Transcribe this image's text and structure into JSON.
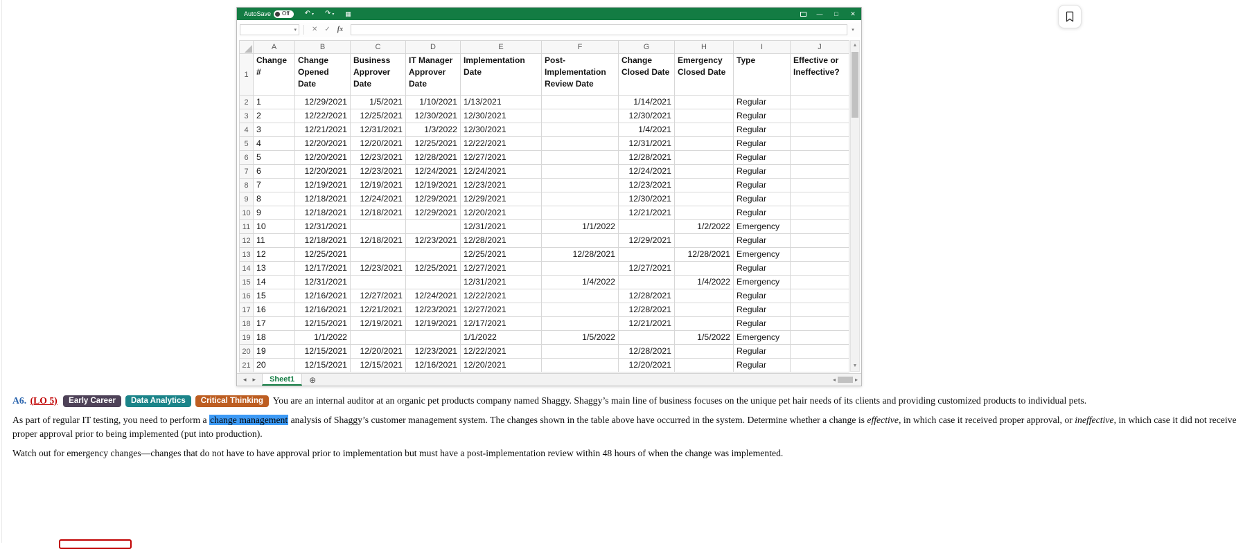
{
  "icons": {
    "undo": "↶",
    "redo": "↷",
    "grid": "▦",
    "minimize": "—",
    "maximize": "□",
    "close": "✕",
    "name_box_dropdown": "▾",
    "cancel": "✕",
    "enter": "✓",
    "expand": "▾",
    "scroll_up": "▲",
    "scroll_down": "▼",
    "scroll_left": "◂",
    "scroll_right": "▸",
    "nav_left": "◂",
    "nav_right": "▸",
    "add_sheet": "⊕",
    "caret": "▾"
  },
  "excel": {
    "titlebar": {
      "autosave_label": "AutoSave",
      "autosave_state": "Off"
    },
    "formula_bar": {
      "fx_label": "fx",
      "name_box_value": "",
      "formula_value": ""
    },
    "sheet": {
      "column_letters": [
        "A",
        "B",
        "C",
        "D",
        "E",
        "F",
        "G",
        "H",
        "I",
        "J"
      ],
      "col_aligns": [
        "left",
        "right",
        "right",
        "right",
        "left",
        "right",
        "right",
        "right",
        "left",
        "left"
      ],
      "headers": [
        "Change #",
        "Change Opened Date",
        "Business Approver Date",
        "IT Manager Approver Date",
        "Implementation Date",
        "Post-Implementation Review Date",
        "Change Closed Date",
        "Emergency Closed Date",
        "Type",
        "Effective or Ineffective?"
      ],
      "rows": [
        {
          "n": "2",
          "cells": [
            "1",
            "12/29/2021",
            "1/5/2021",
            "1/10/2021",
            "1/13/2021",
            "",
            "1/14/2021",
            "",
            "Regular",
            ""
          ]
        },
        {
          "n": "3",
          "cells": [
            "2",
            "12/22/2021",
            "12/25/2021",
            "12/30/2021",
            "12/30/2021",
            "",
            "12/30/2021",
            "",
            "Regular",
            ""
          ]
        },
        {
          "n": "4",
          "cells": [
            "3",
            "12/21/2021",
            "12/31/2021",
            "1/3/2022",
            "12/30/2021",
            "",
            "1/4/2021",
            "",
            "Regular",
            ""
          ]
        },
        {
          "n": "5",
          "cells": [
            "4",
            "12/20/2021",
            "12/20/2021",
            "12/25/2021",
            "12/22/2021",
            "",
            "12/31/2021",
            "",
            "Regular",
            ""
          ]
        },
        {
          "n": "6",
          "cells": [
            "5",
            "12/20/2021",
            "12/23/2021",
            "12/28/2021",
            "12/27/2021",
            "",
            "12/28/2021",
            "",
            "Regular",
            ""
          ]
        },
        {
          "n": "7",
          "cells": [
            "6",
            "12/20/2021",
            "12/23/2021",
            "12/24/2021",
            "12/24/2021",
            "",
            "12/24/2021",
            "",
            "Regular",
            ""
          ]
        },
        {
          "n": "8",
          "cells": [
            "7",
            "12/19/2021",
            "12/19/2021",
            "12/19/2021",
            "12/23/2021",
            "",
            "12/23/2021",
            "",
            "Regular",
            ""
          ]
        },
        {
          "n": "9",
          "cells": [
            "8",
            "12/18/2021",
            "12/24/2021",
            "12/29/2021",
            "12/29/2021",
            "",
            "12/30/2021",
            "",
            "Regular",
            ""
          ]
        },
        {
          "n": "10",
          "cells": [
            "9",
            "12/18/2021",
            "12/18/2021",
            "12/29/2021",
            "12/20/2021",
            "",
            "12/21/2021",
            "",
            "Regular",
            ""
          ]
        },
        {
          "n": "11",
          "cells": [
            "10",
            "12/31/2021",
            "",
            "",
            "12/31/2021",
            "1/1/2022",
            "",
            "1/2/2022",
            "Emergency",
            ""
          ]
        },
        {
          "n": "12",
          "cells": [
            "11",
            "12/18/2021",
            "12/18/2021",
            "12/23/2021",
            "12/28/2021",
            "",
            "12/29/2021",
            "",
            "Regular",
            ""
          ]
        },
        {
          "n": "13",
          "cells": [
            "12",
            "12/25/2021",
            "",
            "",
            "12/25/2021",
            "12/28/2021",
            "",
            "12/28/2021",
            "Emergency",
            ""
          ]
        },
        {
          "n": "14",
          "cells": [
            "13",
            "12/17/2021",
            "12/23/2021",
            "12/25/2021",
            "12/27/2021",
            "",
            "12/27/2021",
            "",
            "Regular",
            ""
          ]
        },
        {
          "n": "15",
          "cells": [
            "14",
            "12/31/2021",
            "",
            "",
            "12/31/2021",
            "1/4/2022",
            "",
            "1/4/2022",
            "Emergency",
            ""
          ]
        },
        {
          "n": "16",
          "cells": [
            "15",
            "12/16/2021",
            "12/27/2021",
            "12/24/2021",
            "12/22/2021",
            "",
            "12/28/2021",
            "",
            "Regular",
            ""
          ]
        },
        {
          "n": "17",
          "cells": [
            "16",
            "12/16/2021",
            "12/21/2021",
            "12/23/2021",
            "12/27/2021",
            "",
            "12/28/2021",
            "",
            "Regular",
            ""
          ]
        },
        {
          "n": "18",
          "cells": [
            "17",
            "12/15/2021",
            "12/19/2021",
            "12/19/2021",
            "12/17/2021",
            "",
            "12/21/2021",
            "",
            "Regular",
            ""
          ]
        },
        {
          "n": "19",
          "cells": [
            "18",
            "1/1/2022",
            "",
            "",
            "1/1/2022",
            "1/5/2022",
            "",
            "1/5/2022",
            "Emergency",
            ""
          ]
        },
        {
          "n": "20",
          "cells": [
            "19",
            "12/15/2021",
            "12/20/2021",
            "12/23/2021",
            "12/22/2021",
            "",
            "12/28/2021",
            "",
            "Regular",
            ""
          ]
        },
        {
          "n": "21",
          "cells": [
            "20",
            "12/15/2021",
            "12/15/2021",
            "12/16/2021",
            "12/20/2021",
            "",
            "12/20/2021",
            "",
            "Regular",
            ""
          ]
        }
      ]
    },
    "tabs": {
      "sheet_name": "Sheet1"
    }
  },
  "problem": {
    "id": "A6.",
    "lo": "(LO 5)",
    "badges": [
      {
        "label": "Early Career",
        "color": "#4e4258"
      },
      {
        "label": "Data Analytics",
        "color": "#1b8489"
      },
      {
        "label": "Critical Thinking",
        "color": "#bd5e22"
      }
    ],
    "highlight_color": "#3d9af5",
    "p1": "You are an internal auditor at an organic pet products company named Shaggy. Shaggy’s main line of business focuses on the unique pet hair needs of its clients and providing customized products to individual pets.",
    "p2_segments": [
      {
        "text": "As part of regular IT testing, you need to perform a ",
        "style": "normal"
      },
      {
        "text": "change management",
        "style": "highlight"
      },
      {
        "text": " analysis of Shaggy’s customer management system. The changes shown in the table above have occurred in the system. Determine whether a change is ",
        "style": "normal"
      },
      {
        "text": "effective,",
        "style": "italic"
      },
      {
        "text": " in which case it received proper approval, or ",
        "style": "normal"
      },
      {
        "text": "ineffective,",
        "style": "italic"
      },
      {
        "text": " in which case it did not receive proper approval prior to being implemented (put into production).",
        "style": "normal"
      }
    ],
    "p3": "Watch out for emergency changes—changes that do not have to have approval prior to implementation but must have a post-implementation review within 48 hours of when the change was implemented."
  }
}
